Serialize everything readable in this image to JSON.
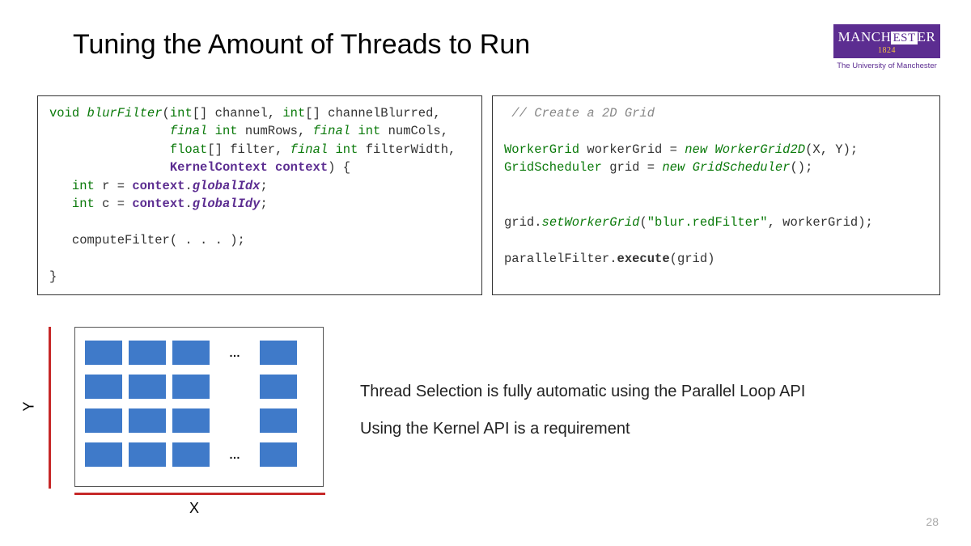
{
  "title": "Tuning the Amount of Threads to Run",
  "logo": {
    "line1a": "MANCH",
    "line1b": "EST",
    "line1c": "ER",
    "year": "1824",
    "sub": "The University of Manchester"
  },
  "code_left": {
    "l1a": "void ",
    "l1b": "blurFilter",
    "l1c": "(",
    "l1d": "int",
    "l1e": "[] channel, ",
    "l1f": "int",
    "l1g": "[] channelBlurred,",
    "l2a": "                ",
    "l2b": "final",
    "l2c": " ",
    "l2d": "int",
    "l2e": " numRows, ",
    "l2f": "final",
    "l2g": " ",
    "l2h": "int",
    "l2i": " numCols,",
    "l3a": "                ",
    "l3b": "float",
    "l3c": "[] filter, ",
    "l3d": "final",
    "l3e": " ",
    "l3f": "int",
    "l3g": " filterWidth,",
    "l4a": "                ",
    "l4b": "KernelContext",
    "l4c": " context",
    "l4d": ") {",
    "l5a": "   ",
    "l5b": "int",
    "l5c": " r = ",
    "l5d": "context",
    "l5e": ".",
    "l5f": "globalIdx",
    "l5g": ";",
    "l6a": "   ",
    "l6b": "int",
    "l6c": " c = ",
    "l6d": "context",
    "l6e": ".",
    "l6f": "globalIdy",
    "l6g": ";",
    "l7": " ",
    "l8": "   computeFilter( . . . );",
    "l9": " ",
    "l10": "}"
  },
  "code_right": {
    "l1": " // Create a 2D Grid",
    "l2": " ",
    "l3a": "WorkerGrid",
    "l3b": " workerGrid = ",
    "l3c": "new",
    "l3d": " ",
    "l3e": "WorkerGrid2D",
    "l3f": "(X, Y);",
    "l4a": "GridScheduler",
    "l4b": " grid = ",
    "l4c": "new",
    "l4d": " ",
    "l4e": "GridScheduler",
    "l4f": "();",
    "l5": " ",
    "l6": " ",
    "l7a": "grid.",
    "l7b": "setWorkerGrid",
    "l7c": "(",
    "l7d": "\"blur.redFilter\"",
    "l7e": ", workerGrid);",
    "l8": " ",
    "l9a": "parallelFilter.",
    "l9b": "execute",
    "l9c": "(grid)"
  },
  "diagram": {
    "x_label": "X",
    "y_label": "Y",
    "ellipsis": "…"
  },
  "right_text": {
    "p1": "Thread Selection is fully automatic using the Parallel Loop API",
    "p2": "Using the Kernel API is a requirement"
  },
  "page_number": "28"
}
